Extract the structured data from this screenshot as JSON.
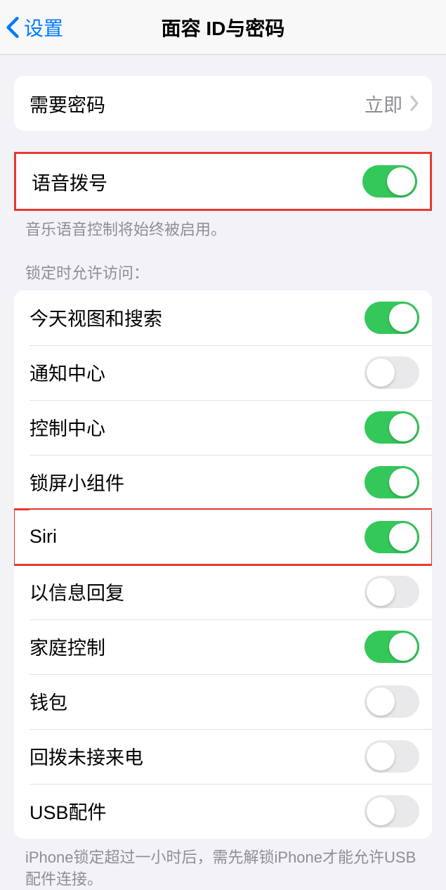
{
  "navbar": {
    "back_label": "设置",
    "title": "面容 ID与密码"
  },
  "passcode_group": {
    "require_passcode": {
      "label": "需要密码",
      "value": "立即"
    }
  },
  "voice_dial_group": {
    "voice_dial": {
      "label": "语音拨号",
      "on": true
    },
    "footer": "音乐语音控制将始终被启用。"
  },
  "lock_access": {
    "header": "锁定时允许访问：",
    "items": [
      {
        "label": "今天视图和搜索",
        "on": true
      },
      {
        "label": "通知中心",
        "on": false
      },
      {
        "label": "控制中心",
        "on": true
      },
      {
        "label": "锁屏小组件",
        "on": true
      },
      {
        "label": "Siri",
        "on": true
      },
      {
        "label": "以信息回复",
        "on": false
      },
      {
        "label": "家庭控制",
        "on": true
      },
      {
        "label": "钱包",
        "on": false
      },
      {
        "label": "回拨未接来电",
        "on": false
      },
      {
        "label": "USB配件",
        "on": false
      }
    ],
    "footer": "iPhone锁定超过一小时后，需先解锁iPhone才能允许USB配件连接。"
  }
}
